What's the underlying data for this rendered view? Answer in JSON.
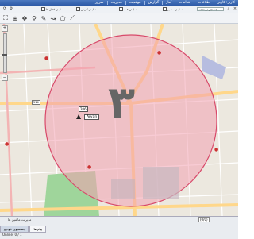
{
  "menu": {
    "items": [
      "کاربر: کاربر",
      "اطلاعات",
      "اقدامات",
      "آمار",
      "گزارش",
      "موقعیت",
      "مدیریت",
      "سرور"
    ]
  },
  "toolbar": {
    "search_value": "جستجو در نقشه",
    "show_route_label": "نمایش مسیر",
    "show_all_label": "نمایش همه",
    "show_address_label": "نمایش آدرس",
    "show_active_label": "نمایش فعال ها"
  },
  "map": {
    "overlay_number": "۳",
    "vehicle_code": "206",
    "vehicle_name": "Aryan",
    "road_number": "514",
    "circle_color": "#f2a0b0",
    "park_color": "#9fd59b",
    "roads_color": "#ffd78a"
  },
  "status": {
    "title": "مدیریت ماشین ها",
    "coords": "(0/0)",
    "tabs": [
      "جستجوی خودرو",
      "پیام ها"
    ],
    "online": "Online: 0 / 1"
  }
}
